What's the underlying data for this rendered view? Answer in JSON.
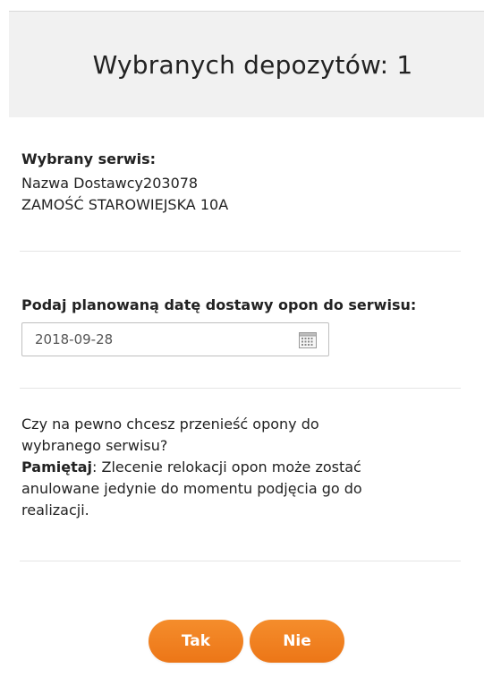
{
  "dialog": {
    "title": "Wybranych depozytów: 1"
  },
  "service": {
    "label": "Wybrany serwis:",
    "provider_name": "Nazwa Dostawcy203078",
    "address": "ZAMOŚĆ STAROWIEJSKA 10A"
  },
  "delivery_date": {
    "label": "Podaj planowaną datę dostawy opon do serwisu:",
    "value": "2018-09-28",
    "icon": "calendar-icon"
  },
  "confirmation": {
    "question_line1": "Czy na pewno chcesz przenieść opony do",
    "question_line2": "wybranego serwisu?",
    "note_label": "Pamiętaj",
    "note_line1_rest": ": Zlecenie relokacji opon może zostać",
    "note_line2": "anulowane jedynie do momentu podjęcia go do",
    "note_line3": "realizacji."
  },
  "buttons": {
    "yes_label": "Tak",
    "no_label": "Nie"
  },
  "colors": {
    "accent": "#f0811f",
    "header_bg": "#f1f1f1"
  }
}
